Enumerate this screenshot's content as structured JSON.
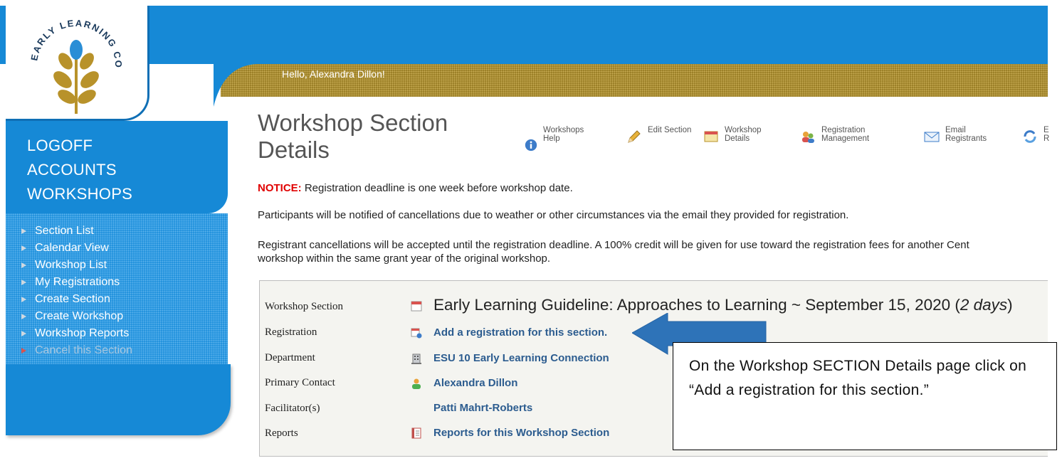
{
  "header": {
    "greeting": "Hello, Alexandra Dillon!"
  },
  "logo": {
    "name": "NEBRASKA EARLY LEARNING CONNECTION"
  },
  "sidebar": {
    "primary_links": [
      {
        "label": "LOGOFF"
      },
      {
        "label": "ACCOUNTS"
      },
      {
        "label": "WORKSHOPS"
      }
    ],
    "menu": [
      {
        "label": "Section List"
      },
      {
        "label": "Calendar View"
      },
      {
        "label": "Workshop List"
      },
      {
        "label": "My Registrations"
      },
      {
        "label": "Create Section"
      },
      {
        "label": "Create Workshop"
      },
      {
        "label": "Workshop Reports"
      },
      {
        "label": "Cancel this Section"
      }
    ]
  },
  "page": {
    "title": "Workshop Section Details"
  },
  "toolbar": [
    {
      "label": "Workshops Help",
      "icon": "info-icon"
    },
    {
      "label": "Edit Section",
      "icon": "pencil-icon"
    },
    {
      "label": "Workshop Details",
      "icon": "calendar-icon"
    },
    {
      "label": "Registration Management",
      "icon": "users-icon"
    },
    {
      "label": "Email Registrants",
      "icon": "envelope-icon"
    },
    {
      "label": "E R",
      "icon": "refresh-icon"
    }
  ],
  "notice": {
    "label": "NOTICE:",
    "text": " Registration deadline is one week before workshop date."
  },
  "paragraphs": {
    "p1": "Participants will be notified of cancellations due to weather or other circumstances via the email they provided for registration.",
    "p2_line1": "Registrant cancellations will be accepted until the registration deadline. A 100% credit will be given for use toward the registration fees for another Cent",
    "p2_line2": "workshop within the same grant year of the original workshop."
  },
  "details": {
    "section_label": "Workshop Section",
    "section_title": "Early Learning Guideline: Approaches to Learning ~ September 15, 2020 (",
    "section_days": "2 days",
    "section_close": ")",
    "rows": [
      {
        "label": "Registration",
        "value": "Add a registration for this section."
      },
      {
        "label": "Department",
        "value": "ESU 10 Early Learning Connection"
      },
      {
        "label": "Primary Contact",
        "value": "Alexandra Dillon"
      },
      {
        "label": "Facilitator(s)",
        "value": "Patti Mahrt-Roberts"
      },
      {
        "label": "Reports",
        "value": "Reports for this Workshop Section"
      }
    ]
  },
  "annotation": {
    "text": "On the Workshop SECTION Details page click on “Add a registration for this section.”",
    "arrow_color": "#2e73b8"
  },
  "colors": {
    "brand_blue": "#1689d6",
    "gold": "#9b7f27",
    "link": "#2c5c8f",
    "notice_red": "#e00000"
  }
}
